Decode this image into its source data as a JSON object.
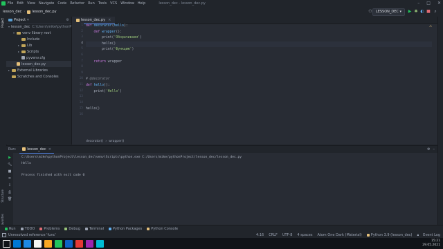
{
  "menubar": {
    "items": [
      "File",
      "Edit",
      "View",
      "Navigate",
      "Code",
      "Refactor",
      "Run",
      "Tools",
      "VCS",
      "Window",
      "Help"
    ],
    "window_title": "lesson_dec - lesson_dec.py"
  },
  "navbar": {
    "project": "lesson_dec",
    "file": "lesson_dec.py",
    "run_config": "LESSON_DEC"
  },
  "project_panel": {
    "title": "Project",
    "tree": [
      {
        "label": "lesson_dec",
        "path": "C:\\Users\\mike\\pythonProject\\lesso",
        "depth": 0,
        "kind": "folder-blue",
        "arrow": "▾"
      },
      {
        "label": "venv  library root",
        "path": "",
        "depth": 1,
        "kind": "folder",
        "arrow": "▾"
      },
      {
        "label": "Include",
        "path": "",
        "depth": 2,
        "kind": "folder",
        "arrow": ""
      },
      {
        "label": "Lib",
        "path": "",
        "depth": 2,
        "kind": "folder",
        "arrow": "▸"
      },
      {
        "label": "Scripts",
        "path": "",
        "depth": 2,
        "kind": "folder",
        "arrow": "▸"
      },
      {
        "label": "pyvenv.cfg",
        "path": "",
        "depth": 2,
        "kind": "file",
        "arrow": ""
      },
      {
        "label": "lesson_dec.py",
        "path": "",
        "depth": 1,
        "kind": "py",
        "arrow": "",
        "selected": true
      },
      {
        "label": "External Libraries",
        "path": "",
        "depth": 0,
        "kind": "folder",
        "arrow": "▸"
      },
      {
        "label": "Scratches and Consoles",
        "path": "",
        "depth": 0,
        "kind": "folder",
        "arrow": ""
      }
    ]
  },
  "editor": {
    "tab": "lesson_dec.py",
    "breadcrumb": [
      "decorator()",
      "wrapper()"
    ],
    "current_line": 4,
    "lines": [
      [
        {
          "t": "def ",
          "c": "kw"
        },
        {
          "t": "decorator",
          "c": "fn"
        },
        {
          "t": "(",
          "c": "plain"
        },
        {
          "t": "hello",
          "c": "fn"
        },
        {
          "t": "):",
          "c": "plain"
        }
      ],
      [
        {
          "t": "    def ",
          "c": "kw"
        },
        {
          "t": "wrapper",
          "c": "fn"
        },
        {
          "t": "():",
          "c": "plain"
        }
      ],
      [
        {
          "t": "        print",
          "c": "plain"
        },
        {
          "t": "(",
          "c": "plain"
        },
        {
          "t": "'Оборачиваем'",
          "c": "str"
        },
        {
          "t": ")",
          "c": "plain"
        }
      ],
      [
        {
          "t": "        hello()",
          "c": "plain"
        }
      ],
      [
        {
          "t": "        print",
          "c": "plain"
        },
        {
          "t": "(",
          "c": "plain"
        },
        {
          "t": "'Функцию'",
          "c": "str"
        },
        {
          "t": ")",
          "c": "plain"
        }
      ],
      [],
      [
        {
          "t": "    return ",
          "c": "kw"
        },
        {
          "t": "wrapper",
          "c": "plain"
        }
      ],
      [],
      [],
      [
        {
          "t": "# @decorator",
          "c": "cm"
        }
      ],
      [
        {
          "t": "def ",
          "c": "kw"
        },
        {
          "t": "hello",
          "c": "fn"
        },
        {
          "t": "():",
          "c": "plain"
        }
      ],
      [
        {
          "t": "    print",
          "c": "plain"
        },
        {
          "t": "(",
          "c": "plain"
        },
        {
          "t": "'Hello'",
          "c": "str"
        },
        {
          "t": ")",
          "c": "plain"
        }
      ],
      [],
      [],
      [
        {
          "t": "hello()",
          "c": "plain"
        }
      ],
      []
    ]
  },
  "run_panel": {
    "label": "Run:",
    "tab": "lesson_dec",
    "console": [
      "C:\\Users\\mike\\pythonProject\\lesson_dec\\venv\\Scripts\\python.exe C:/Users/mike/pythonProject/lesson_dec/lesson_dec.py",
      "Hello",
      "",
      "Process finished with exit code 0"
    ]
  },
  "bottom_tools": [
    {
      "label": "Run",
      "color": "#22c55e"
    },
    {
      "label": "TODO",
      "color": "#9da5b4"
    },
    {
      "label": "Problems",
      "color": "#e06c75"
    },
    {
      "label": "Debug",
      "color": "#98c379"
    },
    {
      "label": "Terminal",
      "color": "#9da5b4"
    },
    {
      "label": "Python Packages",
      "color": "#61afef"
    },
    {
      "label": "Python Console",
      "color": "#e5c07b"
    }
  ],
  "left_tabs": [
    "Project",
    "Structure",
    "Favorites"
  ],
  "statusbar": {
    "message": "Unresolved reference 'func'",
    "position": "4:16",
    "line_sep": "CRLF",
    "encoding": "UTF-8",
    "indent": "4 spaces",
    "theme": "Atom One Dark (Material)",
    "interpreter": "Python 3.9 (lesson_dec)",
    "event_log": "Event Log"
  },
  "taskbar": {
    "time": "15:21",
    "date": "29.05.2021",
    "icons": [
      "#ffffff",
      "#0078d4",
      "#1e88e5",
      "#f5f5f5",
      "#f9a825",
      "#22c55e",
      "#0b63c5",
      "#e53935",
      "#9c27b0",
      "#00bcd4"
    ]
  }
}
